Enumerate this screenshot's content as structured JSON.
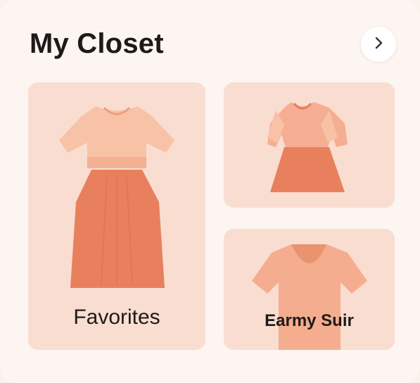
{
  "header": {
    "title": "My Closet",
    "next_icon": "chevron-right-icon"
  },
  "tiles": [
    {
      "label": "Favorites",
      "icon": "dress-illustration"
    },
    {
      "label": "",
      "icon": "short-dress-illustration"
    },
    {
      "label": "Earmy Suir",
      "icon": "t-shirt-illustration"
    }
  ],
  "colors": {
    "tile_bg": "#f9ddd0",
    "garment_light": "#f8c2a6",
    "garment_dark": "#e8805e",
    "card_bg": "#fdf5f1"
  }
}
